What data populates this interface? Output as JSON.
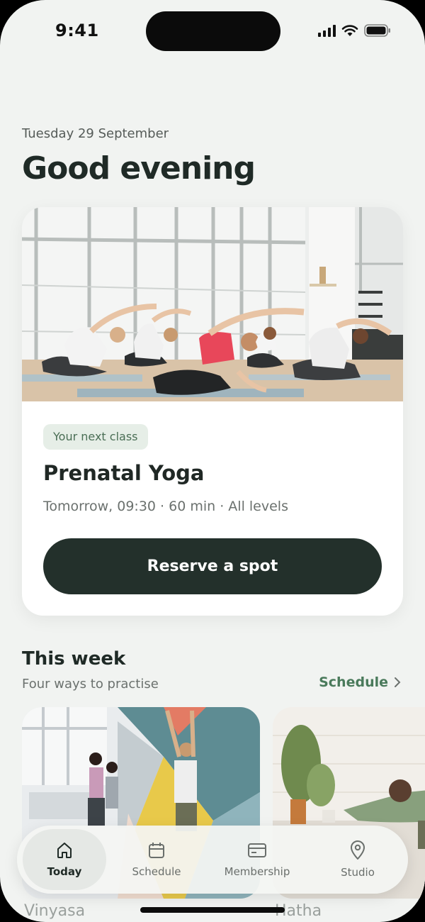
{
  "status_bar": {
    "time": "9:41"
  },
  "header": {
    "date": "Tuesday 29 September",
    "greeting": "Good evening"
  },
  "next_class": {
    "badge": "Your next class",
    "title": "Prenatal Yoga",
    "meta": "Tomorrow, 09:30 · 60 min · All levels",
    "button": "Reserve a spot"
  },
  "this_week": {
    "title": "This week",
    "subtitle": "Four ways to practise",
    "link": "Schedule",
    "cards": [
      {
        "label": "Vinyasa"
      },
      {
        "label": "Hatha"
      }
    ]
  },
  "tabs": [
    {
      "label": "Today",
      "icon": "home-icon",
      "active": true
    },
    {
      "label": "Schedule",
      "icon": "calendar-icon",
      "active": false
    },
    {
      "label": "Membership",
      "icon": "card-icon",
      "active": false
    },
    {
      "label": "Studio",
      "icon": "location-pin-icon",
      "active": false
    }
  ],
  "colors": {
    "background": "#f1f3f1",
    "accent": "#4a7a5b",
    "button": "#23302b",
    "badge_bg": "#e6eee7"
  }
}
